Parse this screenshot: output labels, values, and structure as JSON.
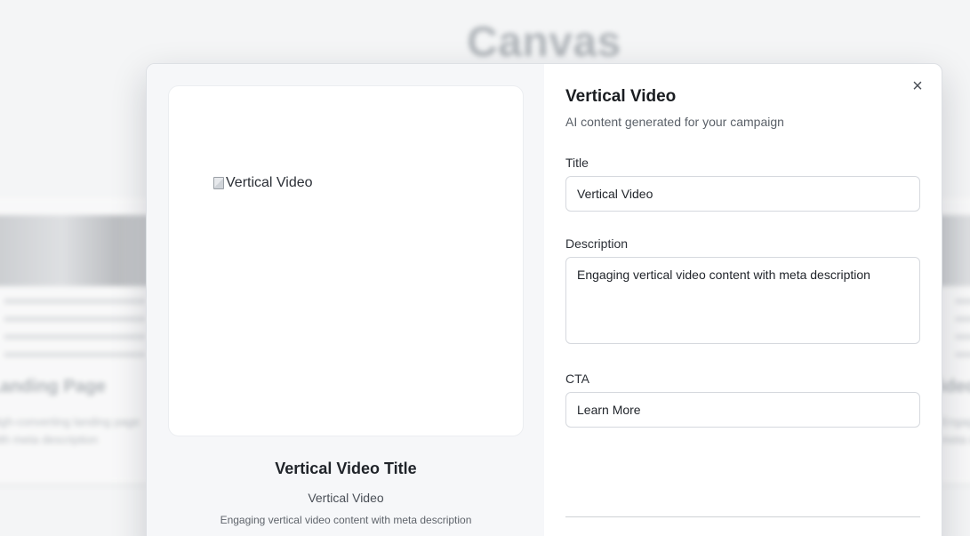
{
  "background": {
    "page_title": "Canvas",
    "cards": [
      {
        "title": "Landing Page",
        "desc_lines": [
          "High-converting landing page",
          "with meta description"
        ]
      },
      {
        "title": "Video",
        "desc_lines": [
          "Engaging vid",
          "meta description"
        ]
      }
    ]
  },
  "modal": {
    "title": "Vertical Video",
    "subtitle": "AI content generated for your campaign",
    "close_icon": "×",
    "preview": {
      "image_alt": "Vertical Video",
      "headline": "Vertical Video Title",
      "subheadline": "Vertical Video",
      "description": "Engaging vertical video content with meta description"
    },
    "fields": {
      "title": {
        "label": "Title",
        "value": "Vertical Video"
      },
      "description": {
        "label": "Description",
        "value": "Engaging vertical video content with meta description"
      },
      "cta": {
        "label": "CTA",
        "value": "Learn More"
      }
    }
  }
}
